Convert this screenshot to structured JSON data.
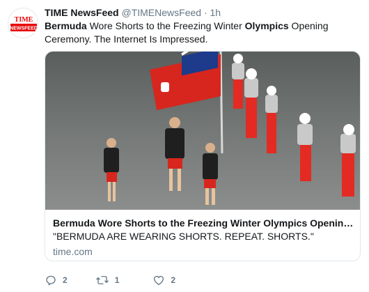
{
  "tweet": {
    "display_name": "TIME NewsFeed",
    "handle": "@TIMENewsFeed",
    "separator": "·",
    "time": "1h",
    "text_parts": {
      "p1_bold": "Bermuda",
      "p2": " Wore Shorts to the Freezing Winter ",
      "p3_bold": "Olympics",
      "p4": " Opening Ceremony. The Internet Is Impressed."
    }
  },
  "avatar": {
    "line1": "TIME",
    "line2": "NEWSFEED",
    "brand_color": "#e90606"
  },
  "card": {
    "title": "Bermuda Wore Shorts to the Freezing Winter Olympics Opening Cere…",
    "description": "\"BERMUDA ARE WEARING SHORTS. REPEAT. SHORTS.\"",
    "domain": "time.com"
  },
  "actions": {
    "reply_count": "2",
    "retweet_count": "1",
    "like_count": "2"
  },
  "colors": {
    "text": "#14171a",
    "secondary": "#657786",
    "border": "#e1e8ed"
  }
}
